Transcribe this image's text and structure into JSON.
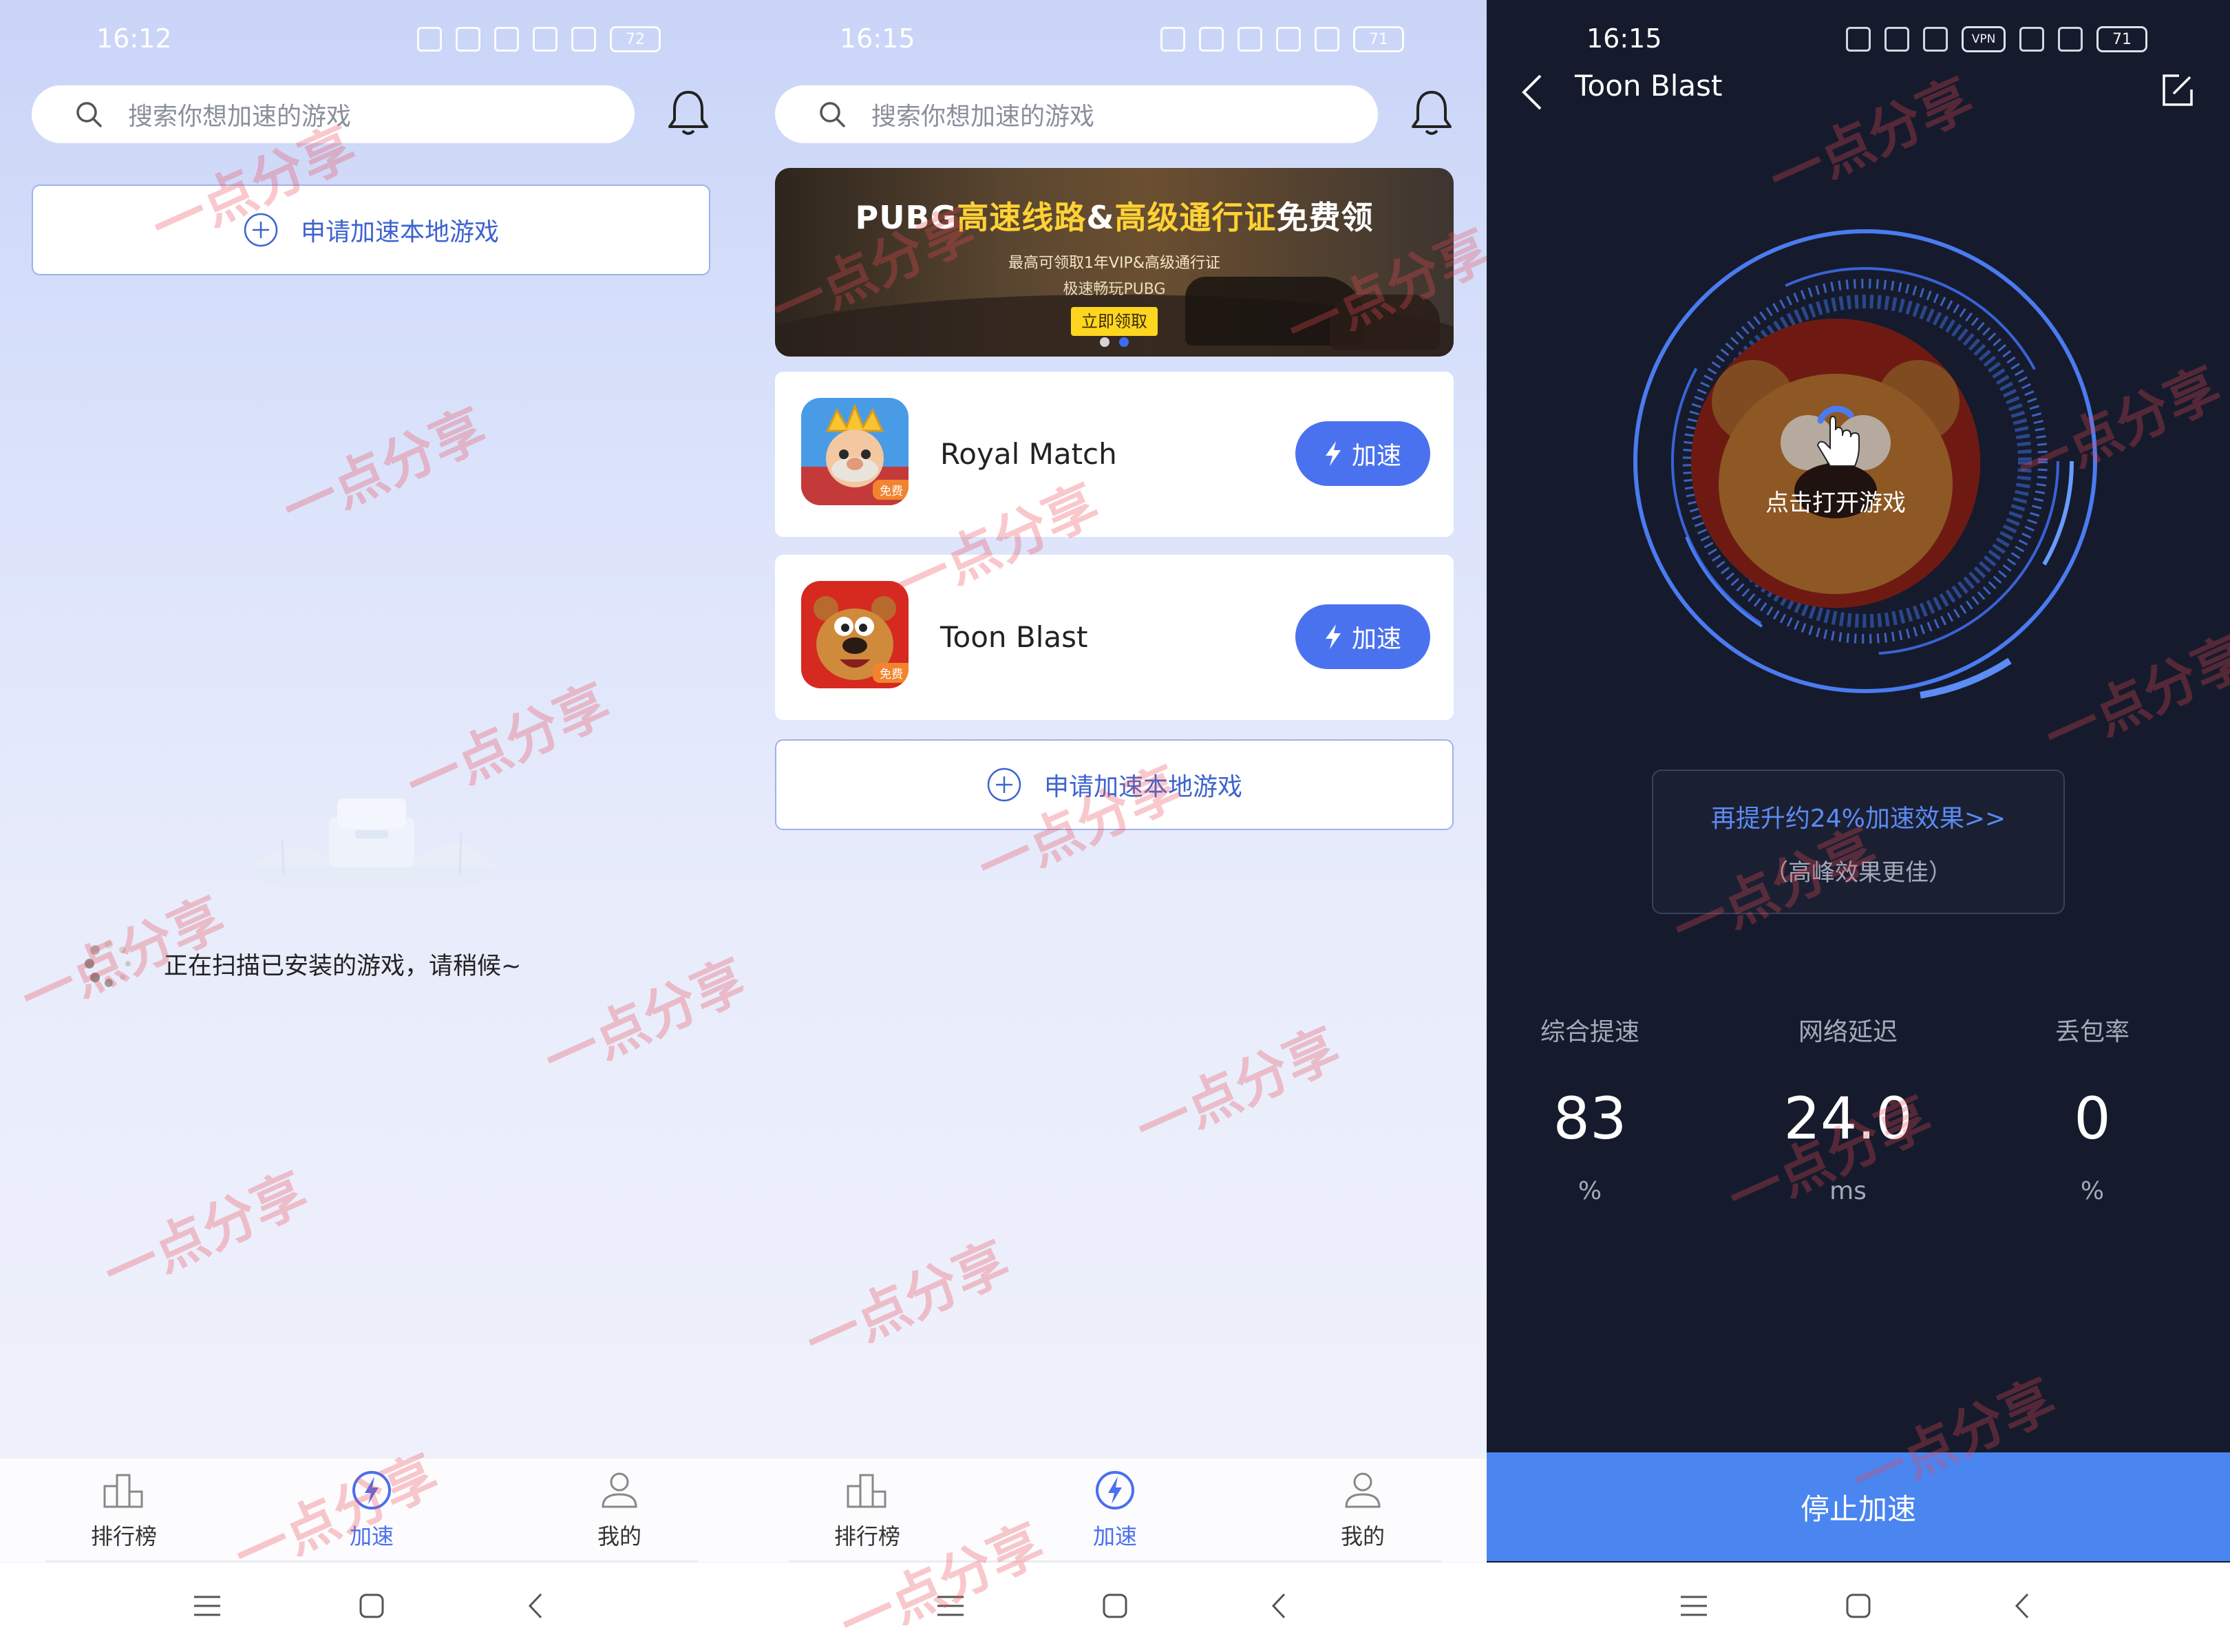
{
  "screens": [
    {
      "time": "16:12",
      "battery": "72",
      "search_placeholder": "搜索你想加速的游戏",
      "add_local_label": "申请加速本地游戏",
      "scanning_text": "正在扫描已安装的游戏，请稍候~"
    },
    {
      "time": "16:15",
      "battery": "71",
      "search_placeholder": "搜索你想加速的游戏",
      "banner": {
        "title_a": "PUBG",
        "title_b": "高速线路",
        "title_c": "&",
        "title_d": "高级通行证",
        "title_e": "免费领",
        "sub1": "最高可领取1年VIP&高级通行证",
        "sub2": "极速畅玩PUBG",
        "button": "立即领取"
      },
      "games": [
        {
          "name": "Royal Match",
          "badge": "免费",
          "button": "加速"
        },
        {
          "name": "Toon Blast",
          "badge": "免费",
          "button": "加速"
        }
      ],
      "add_local_label": "申请加速本地游戏"
    },
    {
      "time": "16:15",
      "battery": "71",
      "vpn_badge": "VPN",
      "game_title": "Toon Blast",
      "open_label": "点击打开游戏",
      "upsell_line1": "再提升约24%加速效果>>",
      "upsell_line2": "（高峰效果更佳）",
      "metrics": [
        {
          "label": "综合提速",
          "value": "83",
          "unit": "%"
        },
        {
          "label": "网络延迟",
          "value": "24.0",
          "unit": "ms"
        },
        {
          "label": "丢包率",
          "value": "0",
          "unit": "%"
        }
      ],
      "stop_button": "停止加速"
    }
  ],
  "nav": {
    "ranking": "排行榜",
    "boost": "加速",
    "mine": "我的"
  },
  "watermark": "一点分享",
  "colors": {
    "accent": "#4b72ee",
    "dark_bg": "#151b2c",
    "stop_button": "#4a85f0",
    "banner_yellow": "#ffd234"
  }
}
